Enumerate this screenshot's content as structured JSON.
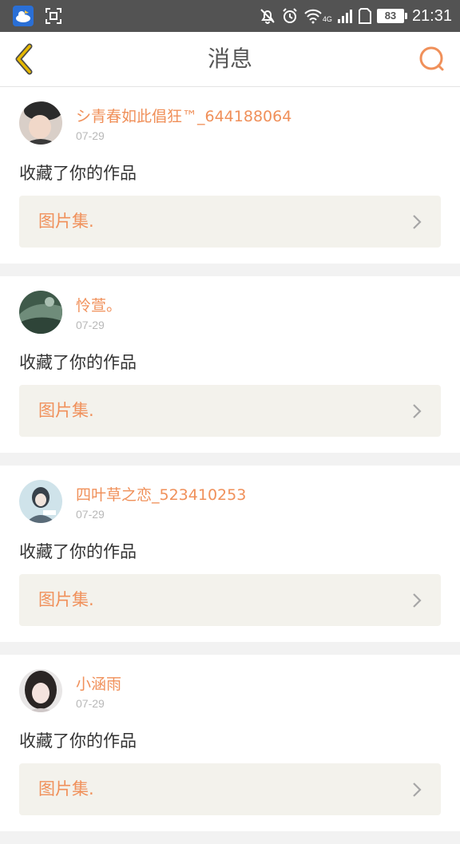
{
  "status_bar": {
    "time": "21:31",
    "battery": "83",
    "network": "4G"
  },
  "nav": {
    "title": "消息"
  },
  "items": [
    {
      "username": "シ青春如此倡狂™_644188064",
      "date": "07-29",
      "action": "收藏了你的作品",
      "work_title": "图片集."
    },
    {
      "username": "怜萱。",
      "date": "07-29",
      "action": "收藏了你的作品",
      "work_title": "图片集."
    },
    {
      "username": "四叶草之恋_523410253",
      "date": "07-29",
      "action": "收藏了你的作品",
      "work_title": "图片集."
    },
    {
      "username": "小涵雨",
      "date": "07-29",
      "action": "收藏了你的作品",
      "work_title": "图片集."
    }
  ],
  "colors": {
    "accent": "#f0905a",
    "back_arrow": "#e6b800",
    "status_bar": "#535353"
  },
  "icons": {
    "back": "back-arrow-icon",
    "search": "search-icon",
    "chevron": "chevron-right-icon"
  }
}
